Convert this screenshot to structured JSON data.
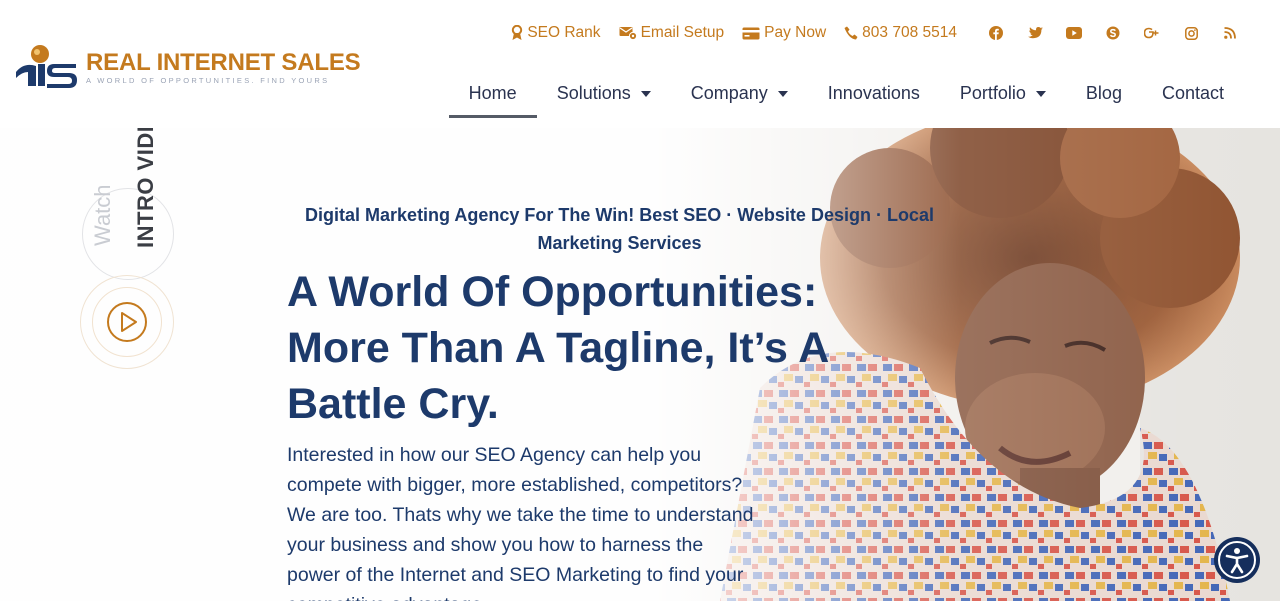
{
  "brand": {
    "name": "REAL INTERNET SALES",
    "tagline": "A WORLD OF OPPORTUNITIES. FIND YOURS",
    "primary_color": "#c47a1e",
    "navy_color": "#1d3a6b"
  },
  "topbar": {
    "items": [
      {
        "label": "SEO Rank",
        "icon": "award-icon"
      },
      {
        "label": "Email Setup",
        "icon": "envelope-gear-icon"
      },
      {
        "label": "Pay Now",
        "icon": "credit-card-icon"
      },
      {
        "label": "803 708 5514",
        "icon": "phone-icon"
      }
    ],
    "social": [
      "facebook-icon",
      "twitter-icon",
      "youtube-icon",
      "skype-icon",
      "google-plus-icon",
      "instagram-icon",
      "rss-icon"
    ]
  },
  "nav": {
    "items": [
      {
        "label": "Home",
        "active": true,
        "dropdown": false
      },
      {
        "label": "Solutions",
        "active": false,
        "dropdown": true
      },
      {
        "label": "Company",
        "active": false,
        "dropdown": true
      },
      {
        "label": "Innovations",
        "active": false,
        "dropdown": false
      },
      {
        "label": "Portfolio",
        "active": false,
        "dropdown": true
      },
      {
        "label": "Blog",
        "active": false,
        "dropdown": false
      },
      {
        "label": "Contact",
        "active": false,
        "dropdown": false
      }
    ]
  },
  "video": {
    "watch_label": "Watch",
    "intro_label": "INTRO VIDEO"
  },
  "hero": {
    "subheadline": "Digital Marketing Agency For The Win! Best SEO · Website Design · Local Marketing Services",
    "headline": "A World Of Opportunities: More Than A Tagline, It’s A Battle Cry.",
    "body": "Interested in how our SEO Agency can help you compete with bigger, more established, competitors? We are too. Thats why we take the time to understand your business and show you how to harness the power of the Internet and SEO Marketing to find your competitive advantage."
  },
  "accessibility": {
    "icon": "accessibility-icon"
  }
}
